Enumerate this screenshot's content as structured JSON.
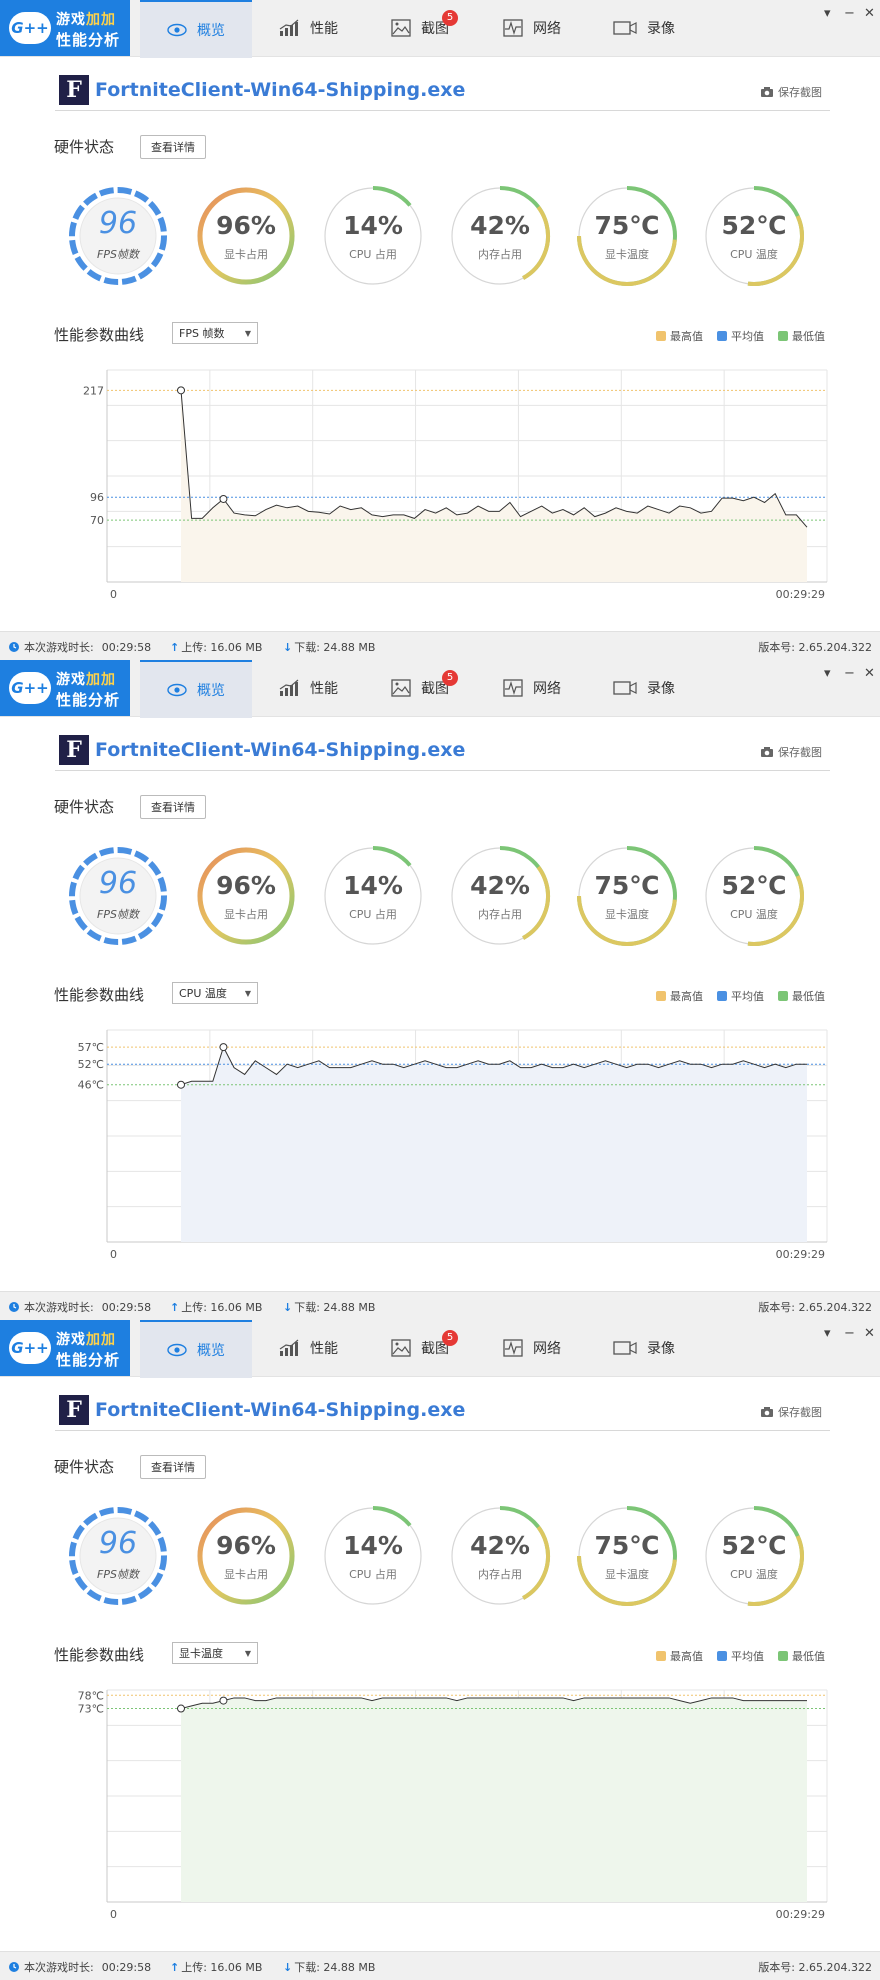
{
  "app": {
    "logo_badge": "G++",
    "logo_line1_a": "游戏",
    "logo_line1_b": "加加",
    "logo_line2": "性能分析"
  },
  "tabs": [
    {
      "label": "概览",
      "icon": "eye-icon"
    },
    {
      "label": "性能",
      "icon": "bar-chart-icon"
    },
    {
      "label": "截图",
      "icon": "image-icon",
      "badge": "5"
    },
    {
      "label": "网络",
      "icon": "pulse-icon"
    },
    {
      "label": "录像",
      "icon": "video-icon"
    }
  ],
  "window_controls": {
    "menu": "▾",
    "minimize": "−",
    "close": "✕"
  },
  "header": {
    "icon_letter": "F",
    "process_name": "FortniteClient-Win64-Shipping.exe",
    "save_screenshot": "保存截图"
  },
  "hardware": {
    "title": "硬件状态",
    "details_button": "查看详情",
    "gauges": [
      {
        "value": "96",
        "label": "FPS帧数",
        "fraction": 1.0,
        "kind": "fps",
        "color": "#4a90e2"
      },
      {
        "value": "96%",
        "label": "显卡占用",
        "fraction": 0.96,
        "kind": "gradient",
        "color": "#7cc576"
      },
      {
        "value": "14%",
        "label": "CPU 占用",
        "fraction": 0.14,
        "kind": "plain",
        "color": "#7cc576"
      },
      {
        "value": "42%",
        "label": "内存占用",
        "fraction": 0.42,
        "kind": "plain",
        "color": "#7cc576"
      },
      {
        "value": "75℃",
        "label": "显卡温度",
        "fraction": 0.75,
        "kind": "plain",
        "color": "#7cc576"
      },
      {
        "value": "52℃",
        "label": "CPU 温度",
        "fraction": 0.52,
        "kind": "plain",
        "color": "#7cc576"
      }
    ]
  },
  "perf": {
    "title": "性能参数曲线",
    "legend": [
      {
        "label": "最高值",
        "color": "#f0c36d"
      },
      {
        "label": "平均值",
        "color": "#4a90e2"
      },
      {
        "label": "最低值",
        "color": "#7cc576"
      }
    ],
    "x_start": "0",
    "x_end": "00:29:29"
  },
  "panels": [
    {
      "select": "FPS 帧数",
      "chart_data": {
        "type": "area",
        "ylim": [
          0,
          240
        ],
        "y_ticks": [
          {
            "v": 217,
            "label": "217"
          },
          {
            "v": 96,
            "label": "96"
          },
          {
            "v": 70,
            "label": "70"
          }
        ],
        "max": 217,
        "avg": 96,
        "min": 70,
        "fill": "#faf5ec",
        "values": [
          217,
          72,
          72,
          84,
          94,
          78,
          76,
          75,
          82,
          87,
          84,
          86,
          80,
          79,
          77,
          86,
          82,
          84,
          76,
          74,
          76,
          76,
          72,
          82,
          78,
          84,
          76,
          78,
          86,
          80,
          80,
          90,
          74,
          80,
          86,
          78,
          82,
          76,
          84,
          74,
          78,
          84,
          80,
          78,
          86,
          82,
          78,
          86,
          84,
          78,
          80,
          95,
          95,
          92,
          96,
          90,
          100,
          76,
          76,
          62
        ],
        "markers": [
          0,
          4
        ]
      },
      "status": {
        "duration_label": "本次游戏时长:",
        "duration": "00:29:58",
        "upload": "上传: 16.06 MB",
        "download": "下载: 24.88 MB",
        "version": "版本号: 2.65.204.322"
      }
    },
    {
      "select": "CPU 温度",
      "chart_data": {
        "type": "area",
        "ylim": [
          0,
          62
        ],
        "y_ticks": [
          {
            "v": 57,
            "label": "57℃"
          },
          {
            "v": 52,
            "label": "52℃"
          },
          {
            "v": 46,
            "label": "46℃"
          }
        ],
        "max": 57,
        "avg": 52,
        "min": 46,
        "fill": "#eef2f9",
        "values": [
          46,
          47,
          47,
          47,
          57,
          51,
          49,
          53,
          51,
          49,
          52,
          51,
          52,
          53,
          51,
          51,
          51,
          52,
          53,
          52,
          52,
          51,
          52,
          53,
          52,
          51,
          51,
          52,
          53,
          52,
          52,
          53,
          51,
          51,
          52,
          51,
          51,
          52,
          51,
          52,
          53,
          52,
          51,
          52,
          52,
          51,
          52,
          53,
          52,
          52,
          51,
          52,
          52,
          53,
          52,
          51,
          52,
          51,
          52,
          52
        ],
        "markers": [
          0,
          4
        ]
      },
      "status": {
        "duration_label": "本次游戏时长:",
        "duration": "00:29:58",
        "upload": "上传: 16.06 MB",
        "download": "下载: 24.88 MB",
        "version": "版本号: 2.65.204.322"
      }
    },
    {
      "select": "显卡温度",
      "chart_data": {
        "type": "area",
        "ylim": [
          0,
          80
        ],
        "y_ticks": [
          {
            "v": 78,
            "label": "78℃"
          },
          {
            "v": 73,
            "label": "73℃"
          }
        ],
        "max": 78,
        "avg": 73,
        "min": 73,
        "fill": "#eef6ec",
        "values": [
          73,
          74,
          75,
          75,
          76,
          77,
          77,
          76,
          76,
          77,
          77,
          77,
          77,
          77,
          77,
          77,
          77,
          77,
          76,
          77,
          77,
          77,
          77,
          77,
          77,
          77,
          76,
          77,
          77,
          77,
          77,
          77,
          77,
          77,
          77,
          77,
          77,
          76,
          77,
          77,
          77,
          77,
          77,
          77,
          77,
          77,
          77,
          76,
          75,
          76,
          77,
          77,
          77,
          76,
          76,
          76,
          76,
          76,
          76,
          76
        ],
        "markers": [
          0,
          4
        ]
      },
      "status": {
        "duration_label": "本次游戏时长:",
        "duration": "00:29:58",
        "upload": "上传: 16.06 MB",
        "download": "下载: 24.88 MB",
        "version": "版本号: 2.65.204.322"
      }
    }
  ]
}
